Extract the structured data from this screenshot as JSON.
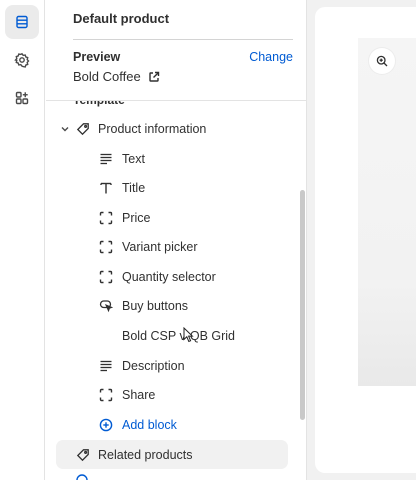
{
  "rail": {
    "items": [
      {
        "icon": "sections-icon",
        "active": true
      },
      {
        "icon": "gear-icon",
        "active": false
      },
      {
        "icon": "apps-icon",
        "active": false
      }
    ]
  },
  "panel": {
    "title": "Default product",
    "preview_label": "Preview",
    "preview_value": "Bold Coffee",
    "change_label": "Change",
    "template_heading": "Template"
  },
  "tree": {
    "group_label": "Product information",
    "blocks": [
      {
        "label": "Text",
        "icon": "text-lines-icon"
      },
      {
        "label": "Title",
        "icon": "title-t-icon"
      },
      {
        "label": "Price",
        "icon": "block-frame-icon"
      },
      {
        "label": "Variant picker",
        "icon": "block-frame-icon"
      },
      {
        "label": "Quantity selector",
        "icon": "block-frame-icon"
      },
      {
        "label": "Buy buttons",
        "icon": "buy-cursor-icon"
      },
      {
        "label": "Bold CSP v-QB Grid",
        "icon": ""
      },
      {
        "label": "Description",
        "icon": "text-lines-icon"
      },
      {
        "label": "Share",
        "icon": "block-frame-icon"
      }
    ],
    "add_block_label": "Add block",
    "related_label": "Related products"
  },
  "colors": {
    "link": "#005bd3",
    "text": "#303030",
    "highlight": "#f1f1f1"
  }
}
